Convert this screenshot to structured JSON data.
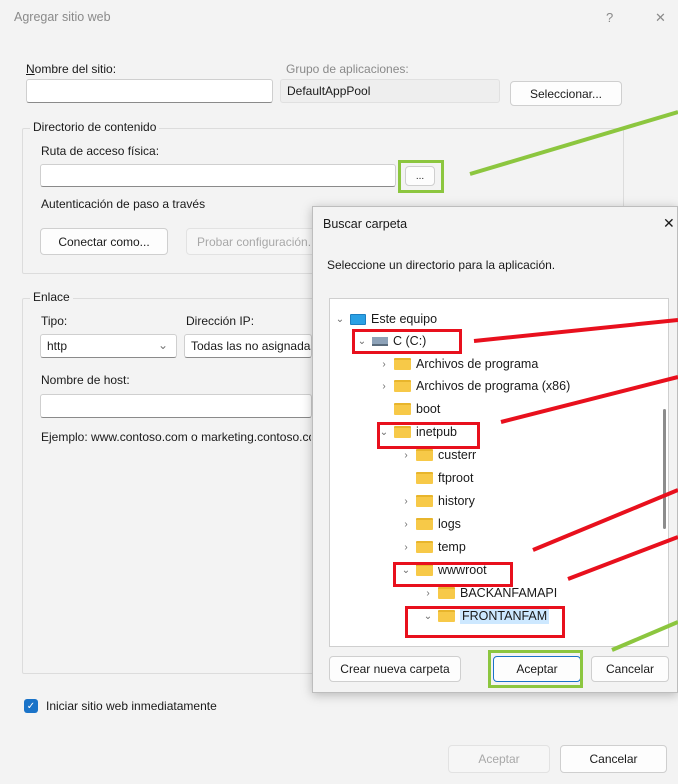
{
  "window": {
    "title": "Agregar sitio web",
    "help_glyph": "?",
    "close_glyph": "✕"
  },
  "site": {
    "name_label": "Nombre del sitio:",
    "name_value": "",
    "app_pool_label": "Grupo de aplicaciones:",
    "app_pool_value": "DefaultAppPool",
    "select_button": "Seleccionar..."
  },
  "content_dir": {
    "group_label": "Directorio de contenido",
    "physical_path_label": "Ruta de acceso física:",
    "physical_path_value": "",
    "browse_button": "...",
    "pass_through_label": "Autenticación de paso a través",
    "connect_as_button": "Conectar como...",
    "test_settings_button": "Probar configuración..."
  },
  "binding": {
    "group_label": "Enlace",
    "type_label": "Tipo:",
    "type_value": "http",
    "ip_label": "Dirección IP:",
    "ip_value": "Todas las no asignadas",
    "host_label": "Nombre de host:",
    "host_value": "",
    "example_text": "Ejemplo: www.contoso.com o marketing.contoso.com"
  },
  "start_immediately": {
    "label": "Iniciar sitio web inmediatamente",
    "checked": true
  },
  "footer": {
    "ok_button": "Aceptar",
    "cancel_button": "Cancelar"
  },
  "folder_dialog": {
    "title": "Buscar carpeta",
    "close_glyph": "✕",
    "prompt": "Seleccione un directorio para la aplicación.",
    "tree": [
      {
        "label": "Este equipo",
        "icon": "pc-icon",
        "chevron": "⌄",
        "level": 0
      },
      {
        "label": "C (C:)",
        "icon": "drive-icon",
        "chevron": "⌄",
        "level": 1
      },
      {
        "label": "Archivos de programa",
        "icon": "folder-icon",
        "chevron": "›",
        "level": 2
      },
      {
        "label": "Archivos de programa (x86)",
        "icon": "folder-icon",
        "chevron": "›",
        "level": 2
      },
      {
        "label": "boot",
        "icon": "folder-icon",
        "chevron": "",
        "level": 2
      },
      {
        "label": "inetpub",
        "icon": "folder-icon",
        "chevron": "⌄",
        "level": 2
      },
      {
        "label": "custerr",
        "icon": "folder-icon",
        "chevron": "›",
        "level": 3
      },
      {
        "label": "ftproot",
        "icon": "folder-icon",
        "chevron": "",
        "level": 3
      },
      {
        "label": "history",
        "icon": "folder-icon",
        "chevron": "›",
        "level": 3
      },
      {
        "label": "logs",
        "icon": "folder-icon",
        "chevron": "›",
        "level": 3
      },
      {
        "label": "temp",
        "icon": "folder-icon",
        "chevron": "›",
        "level": 3
      },
      {
        "label": "wwwroot",
        "icon": "folder-icon",
        "chevron": "⌄",
        "level": 3
      },
      {
        "label": "BACKANFAMAPI",
        "icon": "folder-icon",
        "chevron": "›",
        "level": 4
      },
      {
        "label": "FRONTANFAM",
        "icon": "folder-icon",
        "chevron": "⌄",
        "level": 4,
        "selected": true
      }
    ],
    "new_folder_button": "Crear nueva carpeta",
    "ok_button": "Aceptar",
    "cancel_button": "Cancelar"
  },
  "colors": {
    "highlight_red": "#e8101d",
    "highlight_green": "#8cc63f",
    "accent": "#1a73c8"
  }
}
